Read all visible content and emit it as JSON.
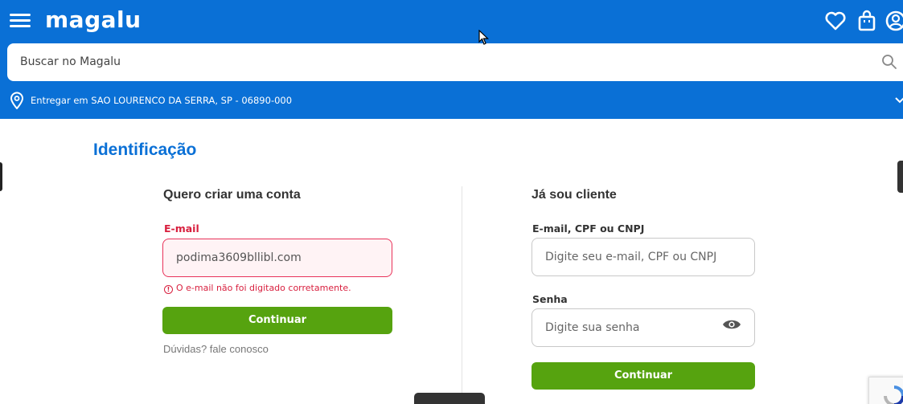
{
  "header": {
    "logo_text": "magalu",
    "icons": [
      "menu-icon",
      "heart-icon",
      "bag-icon",
      "user-icon"
    ],
    "brand_color": "#0a70d6"
  },
  "search": {
    "placeholder": "Buscar no Magalu",
    "icon": "search-icon"
  },
  "location": {
    "text": "Entregar em SAO LOURENCO DA SERRA, SP - 06890-000",
    "icon": "location-pin-icon"
  },
  "page": {
    "title": "Identificação"
  },
  "create_account": {
    "title": "Quero criar uma conta",
    "email_label": "E-mail",
    "email_value": "podima3609bllibl.com",
    "error_message": "O e-mail não foi digitado corretamente.",
    "continue_label": "Continuar",
    "help_text": "Dúvidas? fale conosco"
  },
  "existing_client": {
    "title": "Já sou cliente",
    "login_label": "E-mail, CPF ou CNPJ",
    "login_placeholder": "Digite seu e-mail, CPF ou CNPJ",
    "password_label": "Senha",
    "password_placeholder": "Digite sua senha",
    "continue_label": "Continuar"
  },
  "colors": {
    "accent": "#0a70d6",
    "button": "#56a30f",
    "error": "#d81f3e"
  }
}
